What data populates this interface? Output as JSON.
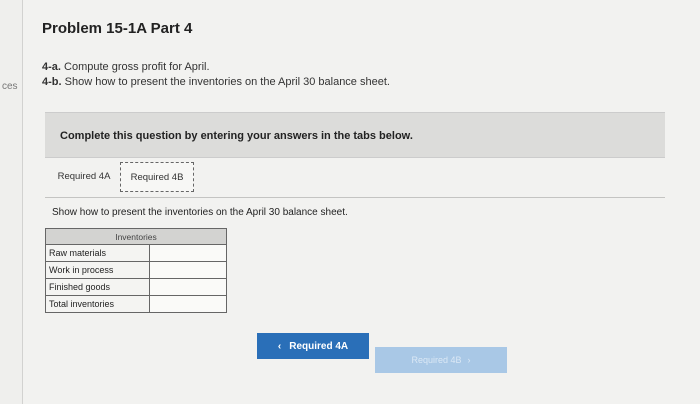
{
  "sidebar": {
    "cut_text": "ces"
  },
  "header": {
    "title": "Problem 15-1A Part 4"
  },
  "instructions": {
    "a_label": "4-a.",
    "a_text": "Compute gross profit for April.",
    "b_label": "4-b.",
    "b_text": "Show how to present the inventories on the April 30 balance sheet."
  },
  "banner": {
    "text": "Complete this question by entering your answers in the tabs below."
  },
  "tabs": [
    {
      "label": "Required 4A"
    },
    {
      "label": "Required 4B"
    }
  ],
  "subquestion": "Show how to present the inventories on the April 30 balance sheet.",
  "table": {
    "header": "Inventories",
    "rows": [
      {
        "label": "Raw materials",
        "value": ""
      },
      {
        "label": "Work in process",
        "value": ""
      },
      {
        "label": "Finished goods",
        "value": ""
      },
      {
        "label": "Total inventories",
        "value": ""
      }
    ]
  },
  "nav": {
    "prev_label": "Required 4A",
    "next_label": "Required 4B",
    "prev_icon": "chevron-left-icon",
    "next_icon": "chevron-right-icon"
  },
  "colors": {
    "accent": "#2a6fb8",
    "disabled": "#a9c8e6"
  }
}
